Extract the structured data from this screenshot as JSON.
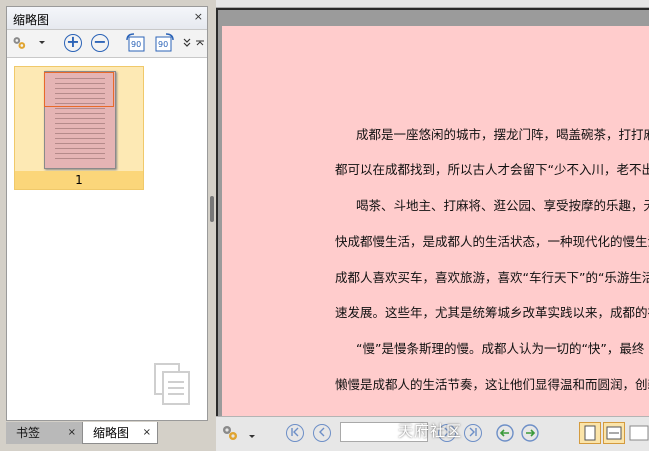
{
  "sidebar": {
    "title": "缩略图",
    "close_label": "×",
    "thumbnail": {
      "page_label": "1"
    }
  },
  "tabs": [
    {
      "label": "书签",
      "close": "×"
    },
    {
      "label": "缩略图",
      "close": "×"
    }
  ],
  "toolbar": {
    "rotate_left_label": "90",
    "rotate_right_label": "90"
  },
  "document": {
    "paragraphs": [
      "成都是一座悠闲的城市，摆龙门阵，喝盖碗茶，打打麻将",
      "都可以在成都找到，所以古人才会留下“少不入川，老不出",
      "喝茶、斗地主、打麻将、逛公园、享受按摩的乐趣，无",
      "快成都慢生活，是成都人的生活状态，一种现代化的慢生活",
      "成都人喜欢买车，喜欢旅游，喜欢“车行天下”的“乐游生活",
      "速发展。这些年，尤其是统筹城乡改革实践以来，成都的社会",
      "“慢”是慢条斯理的慢。成都人认为一切的“快”，最终",
      "懒慢是成都人的生活节奏，这让他们显得温和而圆润，创新而"
    ]
  },
  "status_bar": {
    "watermark": "天府社区"
  },
  "colors": {
    "page_bg": "#ffcccc",
    "thumb_highlight": "#fbd67a",
    "accent": "#2b63b7"
  }
}
